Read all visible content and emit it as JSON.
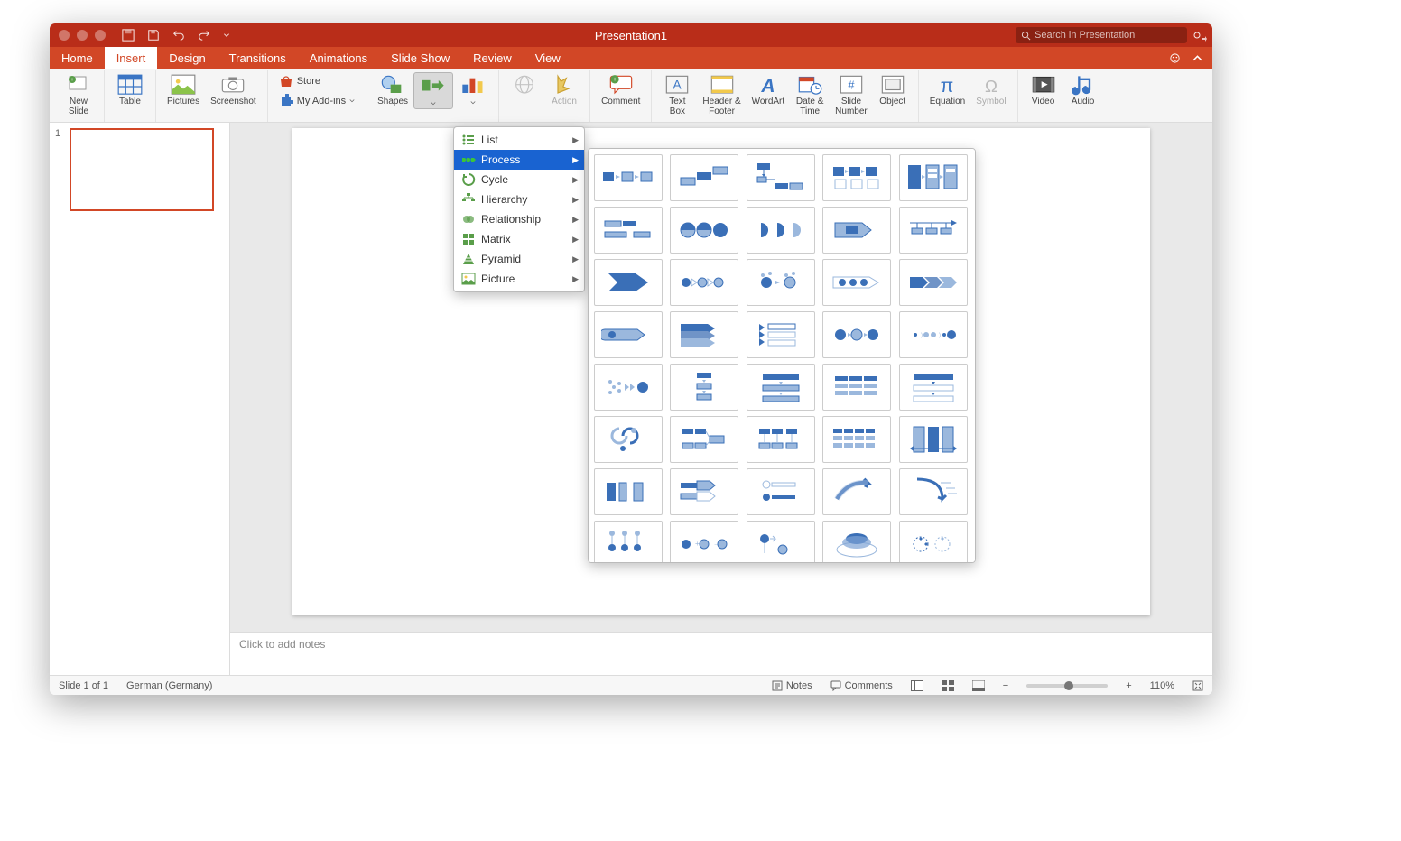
{
  "title": "Presentation1",
  "search": {
    "placeholder": "Search in Presentation"
  },
  "tabs": {
    "home": "Home",
    "insert": "Insert",
    "design": "Design",
    "transitions": "Transitions",
    "animations": "Animations",
    "slideshow": "Slide Show",
    "review": "Review",
    "view": "View"
  },
  "ribbon": {
    "new_slide": "New\nSlide",
    "table": "Table",
    "pictures": "Pictures",
    "screenshot": "Screenshot",
    "store": "Store",
    "my_addins": "My Add-ins",
    "shapes": "Shapes",
    "action": "Action",
    "comment": "Comment",
    "text_box": "Text\nBox",
    "header_footer": "Header &\nFooter",
    "wordart": "WordArt",
    "date_time": "Date &\nTime",
    "slide_number": "Slide\nNumber",
    "object": "Object",
    "equation": "Equation",
    "symbol": "Symbol",
    "video": "Video",
    "audio": "Audio"
  },
  "smartart_menu": {
    "list": "List",
    "process": "Process",
    "cycle": "Cycle",
    "hierarchy": "Hierarchy",
    "relationship": "Relationship",
    "matrix": "Matrix",
    "pyramid": "Pyramid",
    "picture": "Picture"
  },
  "thumbnail": {
    "num": "1"
  },
  "notes_placeholder": "Click to add notes",
  "status": {
    "slide_of": "Slide 1 of 1",
    "lang": "German (Germany)",
    "notes": "Notes",
    "comments": "Comments",
    "zoom": "110%"
  }
}
